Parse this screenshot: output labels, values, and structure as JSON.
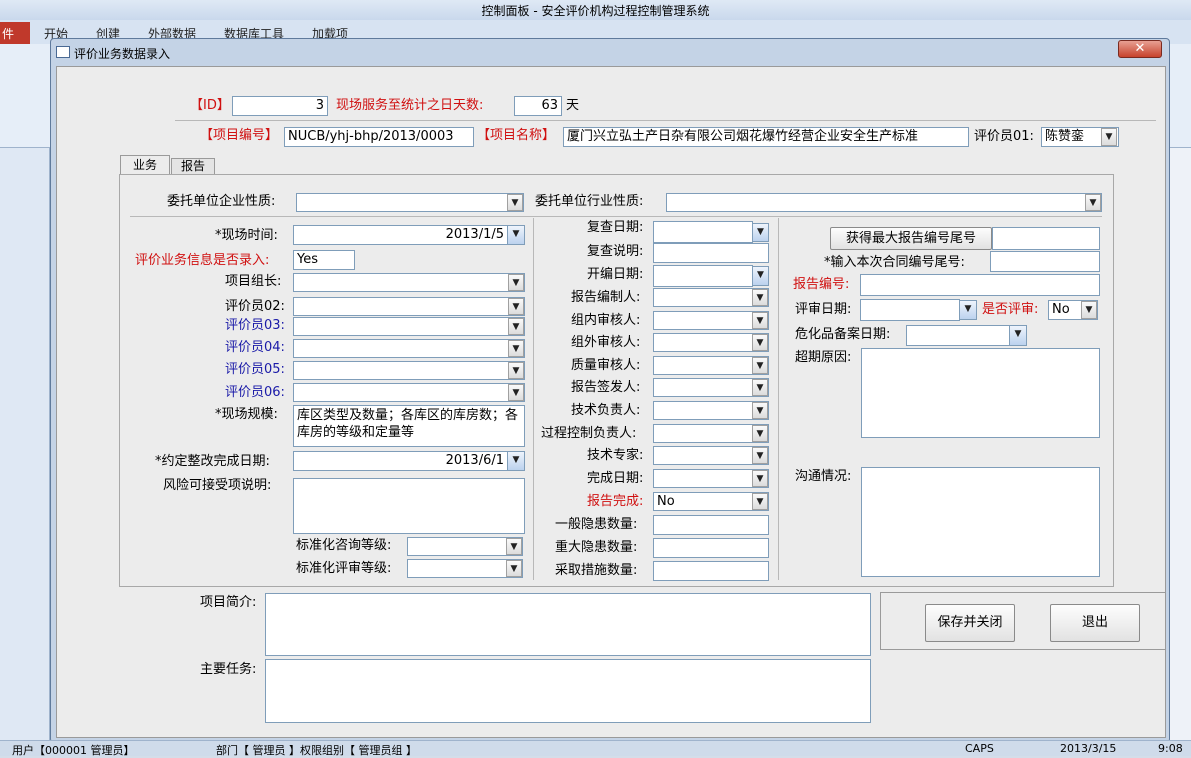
{
  "app": {
    "title": "控制面板 - 安全评价机构过程控制管理系统",
    "file_tab": "件",
    "tabs": [
      "开始",
      "创建",
      "外部数据",
      "数据库工具",
      "加载项"
    ]
  },
  "dialog": {
    "title": "评价业务数据录入",
    "close": "✕"
  },
  "header": {
    "id_label": "【ID】",
    "id_value": "3",
    "days_label": "现场服务至统计之日天数:",
    "days_value": "63",
    "days_unit": "天",
    "project_no_label": "【项目编号】",
    "project_no_value": "NUCB/yhj-bhp/2013/0003",
    "project_name_label": "【项目名称】",
    "project_name_value": "厦门兴立弘土产日杂有限公司烟花爆竹经营企业安全生产标准",
    "evaluator01_label": "评价员01:",
    "evaluator01_value": "陈赞銮"
  },
  "tabs": {
    "business": "业务",
    "report": "报告"
  },
  "top_row": {
    "client_nature_label": "委托单位企业性质:",
    "client_industry_label": "委托单位行业性质:"
  },
  "left": {
    "site_time_label": "*现场时间:",
    "site_time_value": "2013/1/5",
    "entered_label": "评价业务信息是否录入:",
    "entered_value": "Yes",
    "leader_label": "项目组长:",
    "ev02_label": "评价员02:",
    "ev03_label": "评价员03:",
    "ev04_label": "评价员04:",
    "ev05_label": "评价员05:",
    "ev06_label": "评价员06:",
    "scale_label": "*现场规模:",
    "scale_value": "库区类型及数量；各库区的库房数；各库房的等级和定量等",
    "rectify_label": "*约定整改完成日期:",
    "rectify_value": "2013/6/1",
    "risk_label": "风险可接受项说明:",
    "std_consult_label": "标准化咨询等级:",
    "std_review_label": "标准化评审等级:"
  },
  "middle": {
    "recheck_date_label": "复查日期:",
    "recheck_note_label": "复查说明:",
    "compile_date_label": "开编日期:",
    "compiler_label": "报告编制人:",
    "inner_review_label": "组内审核人:",
    "outer_review_label": "组外审核人:",
    "quality_review_label": "质量审核人:",
    "issuer_label": "报告签发人:",
    "tech_lead_label": "技术负责人:",
    "process_lead_label": "过程控制负责人:",
    "expert_label": "技术专家:",
    "finish_date_label": "完成日期:",
    "report_done_label": "报告完成:",
    "report_done_value": "No",
    "general_hazard_label": "一般隐患数量:",
    "major_hazard_label": "重大隐患数量:",
    "measures_label": "采取措施数量:"
  },
  "right": {
    "get_max_button": "获得最大报告编号尾号",
    "input_contract_label": "*输入本次合同编号尾号:",
    "report_no_label": "报告编号:",
    "review_date_label": "评审日期:",
    "is_review_label": "是否评审:",
    "is_review_value": "No",
    "chem_record_label": "危化品备案日期:",
    "overdue_label": "超期原因:",
    "comm_label": "沟通情况:"
  },
  "bottom": {
    "intro_label": "项目简介:",
    "tasks_label": "主要任务:",
    "save_close_button": "保存并关闭",
    "exit_button": "退出"
  },
  "status": {
    "user": "用户【000001 管理员】",
    "dept": "部门【 管理员 】权限组别【 管理员组 】",
    "caps": "CAPS",
    "date": "2013/3/15",
    "time": "9:08"
  },
  "colors": {
    "required_red": "#d01010",
    "optional_blue": "#1a1aa8",
    "dialog_frame": "#c4d3e6"
  },
  "icons": {
    "dropdown": "▼"
  }
}
